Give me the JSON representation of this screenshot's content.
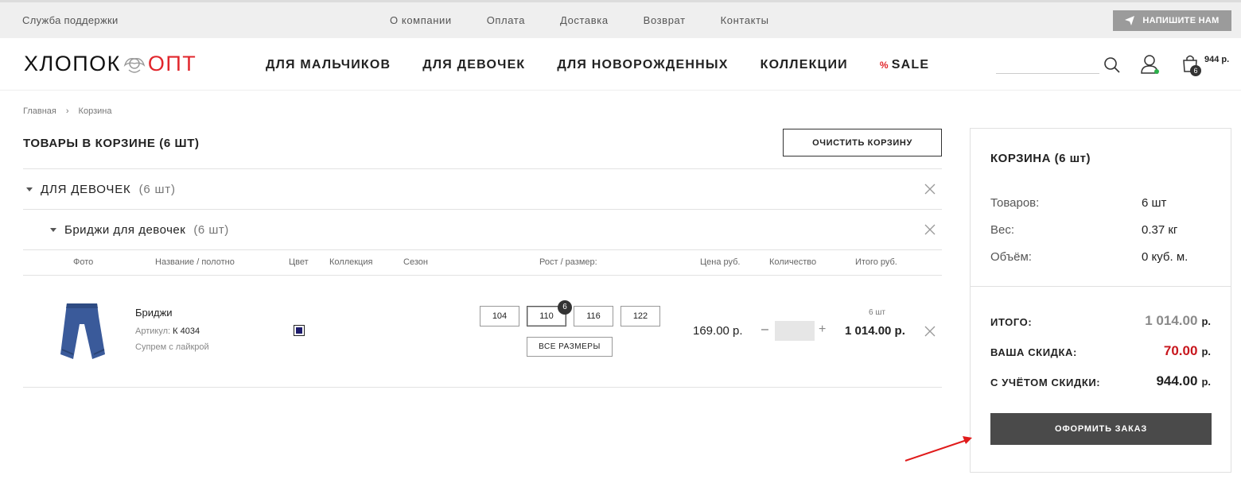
{
  "topbar": {
    "support": "Служба поддержки",
    "nav": [
      "О компании",
      "Оплата",
      "Доставка",
      "Возврат",
      "Контакты"
    ],
    "write_label": "НАПИШИТЕ НАМ"
  },
  "header": {
    "logo_left": "ХЛОПОК",
    "logo_right": "ОПТ",
    "nav": [
      "ДЛЯ МАЛЬЧИКОВ",
      "ДЛЯ ДЕВОЧЕК",
      "ДЛЯ НОВОРОЖДЕННЫХ",
      "КОЛЛЕКЦИИ"
    ],
    "sale_pct": "%",
    "sale_label": "SALE",
    "cart_count": "6",
    "cart_sum": "944 р."
  },
  "breadcrumbs": [
    "Главная",
    "Корзина"
  ],
  "cart": {
    "title": "ТОВАРЫ В КОРЗИНЕ  (6 ШТ)",
    "clear_label": "ОЧИСТИТЬ КОРЗИНУ",
    "group": {
      "name": "ДЛЯ ДЕВОЧЕК",
      "count": "(6 шт)"
    },
    "subgroup": {
      "name": "Бриджи для девочек",
      "count": "(6 шт)"
    },
    "columns": [
      "Фото",
      "Название / полотно",
      "Цвет",
      "Коллекция",
      "Сезон",
      "Рост / размер:",
      "Цена руб.",
      "Количество",
      "Итого руб."
    ],
    "item": {
      "name": "Бриджи",
      "article_label": "Артикул:",
      "article": "К 4034",
      "fabric": "Супрем с лайкрой",
      "color": "#1d1b6b",
      "sizes": [
        "104",
        "110",
        "116",
        "122"
      ],
      "selected_size_count": "6",
      "all_sizes_label": "ВСЕ РАЗМЕРЫ",
      "price": "169.00 р.",
      "qty_minus": "–",
      "qty_plus": "+",
      "total_count": "6 шт",
      "total": "1 014.00 р."
    }
  },
  "summary": {
    "title": "КОРЗИНА (6 шт)",
    "rows": [
      {
        "label": "Товаров:",
        "value": "6 шт"
      },
      {
        "label": "Вес:",
        "value": "0.37 кг"
      },
      {
        "label": "Объём:",
        "value": "0 куб. м."
      }
    ],
    "total_label": "ИТОГО:",
    "total_value": "1 014.00",
    "discount_label": "ВАША СКИДКА:",
    "discount_value": "70.00",
    "final_label": "С УЧЁТОМ СКИДКИ:",
    "final_value": "944.00",
    "currency": "р.",
    "order_label": "ОФОРМИТЬ ЗАКАЗ"
  },
  "colors": {
    "accent": "#e1262c",
    "button_dark": "#4a4a4a",
    "discount": "#c8161d",
    "muted_total": "#8a8a8a"
  }
}
